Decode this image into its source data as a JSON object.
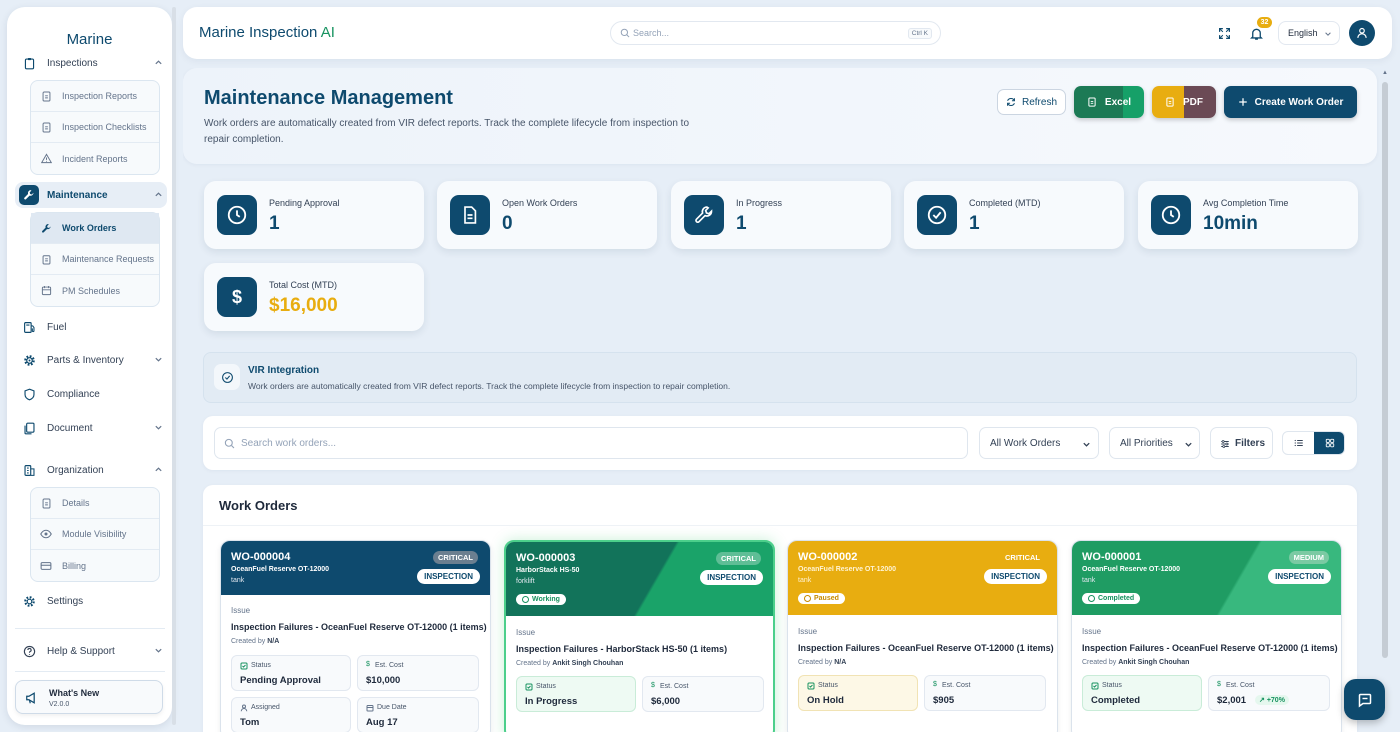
{
  "sidebar": {
    "brand": "Marine",
    "inspections": {
      "label": "Inspections",
      "items": [
        "Inspection Reports",
        "Inspection Checklists",
        "Incident Reports"
      ]
    },
    "maintenance": {
      "label": "Maintenance",
      "items": [
        "Work Orders",
        "Maintenance Requests",
        "PM Schedules"
      ]
    },
    "fuel": "Fuel",
    "parts": "Parts & Inventory",
    "compliance": "Compliance",
    "document": "Document",
    "organization": {
      "label": "Organization",
      "items": [
        "Details",
        "Module Visibility",
        "Billing"
      ]
    },
    "settings": "Settings",
    "help": "Help & Support",
    "whats_new": {
      "title": "What's New",
      "version": "V2.0.0"
    }
  },
  "topbar": {
    "title": "Marine Inspection",
    "title_suffix": "AI",
    "search_placeholder": "Search...",
    "search_shortcut": "Ctrl K",
    "notification_count": "32",
    "language": "English"
  },
  "page": {
    "title": "Maintenance Management",
    "description": "Work orders are automatically created from VIR defect reports. Track the complete lifecycle from inspection to repair completion.",
    "buttons": {
      "refresh": "Refresh",
      "excel": "Excel",
      "pdf": "PDF",
      "create": "Create Work Order"
    }
  },
  "stats": [
    {
      "label": "Pending Approval",
      "value": "1",
      "icon": "clock-icon"
    },
    {
      "label": "Open Work Orders",
      "value": "0",
      "icon": "document-icon"
    },
    {
      "label": "In Progress",
      "value": "1",
      "icon": "wrench-icon"
    },
    {
      "label": "Completed (MTD)",
      "value": "1",
      "icon": "check-circle-icon"
    },
    {
      "label": "Avg Completion Time",
      "value": "10min",
      "icon": "clock-icon"
    },
    {
      "label": "Total Cost (MTD)",
      "value": "$16,000",
      "icon": "dollar-icon"
    }
  ],
  "vir": {
    "title": "VIR Integration",
    "text": "Work orders are automatically created from VIR defect reports. Track the complete lifecycle from inspection to repair completion."
  },
  "filters": {
    "search_placeholder": "Search work orders...",
    "type": "All Work Orders",
    "priority": "All Priorities",
    "filters_label": "Filters"
  },
  "work_orders": {
    "heading": "Work Orders",
    "issue_label": "Issue",
    "created_by_label": "Created by",
    "status_label": "Status",
    "cost_label": "Est. Cost",
    "assigned_label": "Assigned",
    "due_label": "Due Date",
    "items": [
      {
        "id": "WO-000004",
        "location": "OceanFuel Reserve OT-12000",
        "type": "tank",
        "severity": "CRITICAL",
        "category": "INSPECTION",
        "state": "",
        "issue": "Inspection Failures - OceanFuel Reserve OT-12000 (1 items)",
        "created_by": "N/A",
        "status": "Pending Approval",
        "cost": "$10,000",
        "cost_delta": "",
        "assigned": "Tom",
        "due": "Aug 17",
        "color": "#0e4a6e"
      },
      {
        "id": "WO-000003",
        "location": "HarborStack HS-50",
        "type": "forklift",
        "severity": "CRITICAL",
        "category": "INSPECTION",
        "state": "Working",
        "issue": "Inspection Failures - HarborStack HS-50 (1 items)",
        "created_by": "Ankit Singh Chouhan",
        "status": "In Progress",
        "cost": "$6,000",
        "cost_delta": "",
        "assigned": "",
        "due": "",
        "color": "#16925f"
      },
      {
        "id": "WO-000002",
        "location": "OceanFuel Reserve OT-12000",
        "type": "tank",
        "severity": "CRITICAL",
        "category": "INSPECTION",
        "state": "Paused",
        "issue": "Inspection Failures - OceanFuel Reserve OT-12000 (1 items)",
        "created_by": "N/A",
        "status": "On Hold",
        "cost": "$905",
        "cost_delta": "",
        "assigned": "",
        "due": "",
        "color": "#e8ad10"
      },
      {
        "id": "WO-000001",
        "location": "OceanFuel Reserve OT-12000",
        "type": "tank",
        "severity": "MEDIUM",
        "category": "INSPECTION",
        "state": "Completed",
        "issue": "Inspection Failures - OceanFuel Reserve OT-12000 (1 items)",
        "created_by": "Ankit Singh Chouhan",
        "status": "Completed",
        "cost": "$2,001",
        "cost_delta": "+70%",
        "assigned": "",
        "due": "",
        "color": "#22a86a"
      }
    ]
  }
}
